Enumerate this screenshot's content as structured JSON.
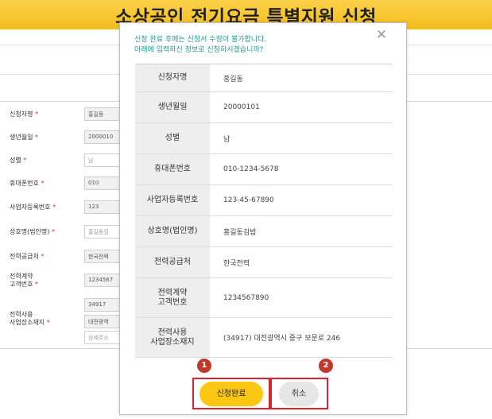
{
  "page": {
    "title": "소상공인 전기요금 특별지원 신청",
    "form_fields": [
      {
        "label": "신청자명",
        "value": "홍길동",
        "placeholder": ""
      },
      {
        "label": "생년월일",
        "value": "2000010",
        "placeholder": ""
      },
      {
        "label": "성별",
        "value": "남",
        "placeholder": ""
      },
      {
        "label": "휴대폰번호",
        "value": "010",
        "placeholder": ""
      },
      {
        "label": "사업자등록번호",
        "value": "123",
        "placeholder": ""
      },
      {
        "label": "상호명(법인명)",
        "value": "홍길동김",
        "placeholder": ""
      },
      {
        "label": "전력공급처",
        "value": "한국전력",
        "placeholder": ""
      },
      {
        "label": "전력계약\n고객번호",
        "value": "1234567",
        "placeholder": ""
      },
      {
        "label": "전력사용\n사업장소재지",
        "value": "34917",
        "value2": "대전광역",
        "placeholder": "상세주소"
      }
    ],
    "required_mark": "*"
  },
  "modal": {
    "notice_line1": "신청 완료 후에는 신청서 수정이 불가합니다.",
    "notice_line2": "아래에 입력하신 정보로 신청하시겠습니까?",
    "close_glyph": "✕",
    "rows": [
      {
        "label": "신청자명",
        "value": "홍길동"
      },
      {
        "label": "생년월일",
        "value": "20000101"
      },
      {
        "label": "성별",
        "value": "남"
      },
      {
        "label": "휴대폰번호",
        "value": "010-1234-5678"
      },
      {
        "label": "사업자등록번호",
        "value": "123-45-67890"
      },
      {
        "label": "상호명(법인명)",
        "value": "홍길동김밥"
      },
      {
        "label": "전력공급처",
        "value": "한국전력"
      },
      {
        "label": "전력계약\n고객번호",
        "value": "1234567890"
      },
      {
        "label": "전력사용\n사업장소재지",
        "value": "(34917) 대전광역시 중구 보문로 246"
      }
    ],
    "badges": [
      "1",
      "2"
    ],
    "submit_label": "신청완료",
    "cancel_label": "취소"
  },
  "colors": {
    "banner": "#f4bd1b",
    "notice_text": "#1d9b8c",
    "required": "#e4293a",
    "badge": "#c0392b",
    "highlight_border": "#e0202a",
    "submit_button": "#fbc712"
  }
}
